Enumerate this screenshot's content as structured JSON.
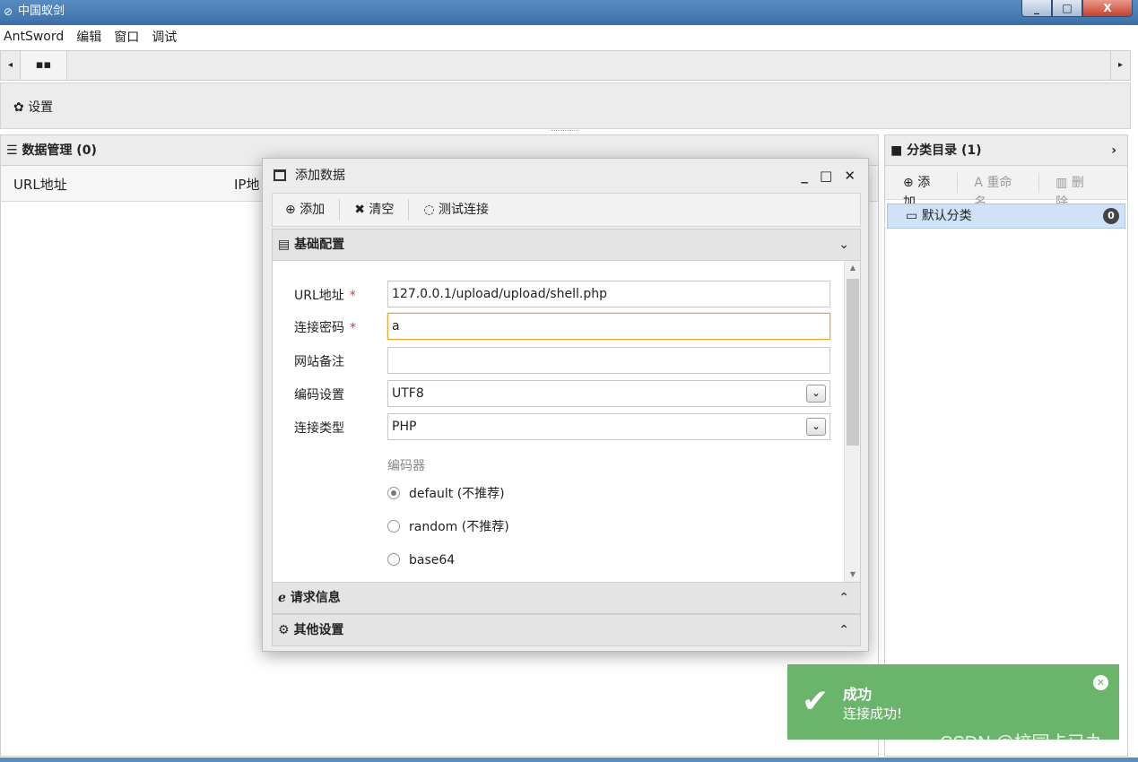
{
  "window": {
    "title": "中国蚁剑",
    "icon": "antsword-logo-icon",
    "controls": {
      "minimize": "_",
      "maximize": "□",
      "close": "X"
    }
  },
  "menu": [
    "AntSword",
    "编辑",
    "窗口",
    "调试"
  ],
  "tabs": {
    "scroll_left": "◂",
    "home_icon": "grid-icon",
    "scroll_right": "▸"
  },
  "toolbar": {
    "settings_label": "设置"
  },
  "left_panel": {
    "title": "数据管理 (0)",
    "columns": [
      "URL地址",
      "IP地"
    ]
  },
  "right_panel": {
    "title": "分类目录 (1)",
    "collapse": "›",
    "buttons": {
      "add": "添加",
      "rename": "重命名",
      "delete": "删除"
    },
    "categories": [
      {
        "label": "默认分类",
        "count": "0"
      }
    ]
  },
  "dialog": {
    "title": "添加数据",
    "controls": "_ □ ✕",
    "toolbar": {
      "add": "添加",
      "clear": "清空",
      "test": "测试连接"
    },
    "sections": {
      "basic": "基础配置",
      "request": "请求信息",
      "other": "其他设置"
    },
    "form": {
      "url_label": "URL地址",
      "url_value": "127.0.0.1/upload/upload/shell.php",
      "password_label": "连接密码",
      "password_value": "a",
      "note_label": "网站备注",
      "note_value": "",
      "encoding_label": "编码设置",
      "encoding_value": "UTF8",
      "type_label": "连接类型",
      "type_value": "PHP",
      "required_mark": "*",
      "encoder_label": "编码器",
      "encoders": [
        {
          "label": "default (不推荐)",
          "checked": true
        },
        {
          "label": "random (不推荐)",
          "checked": false
        },
        {
          "label": "base64",
          "checked": false
        }
      ]
    }
  },
  "toast": {
    "title": "成功",
    "message": "连接成功!",
    "close": "✕"
  },
  "watermark": "CSDN @校园卡已办",
  "colors": {
    "toast_bg": "#6ab56b",
    "selected_bg": "#cfe2f7",
    "focus_border": "#e3a832",
    "titlebar": "#3c6ea8"
  }
}
